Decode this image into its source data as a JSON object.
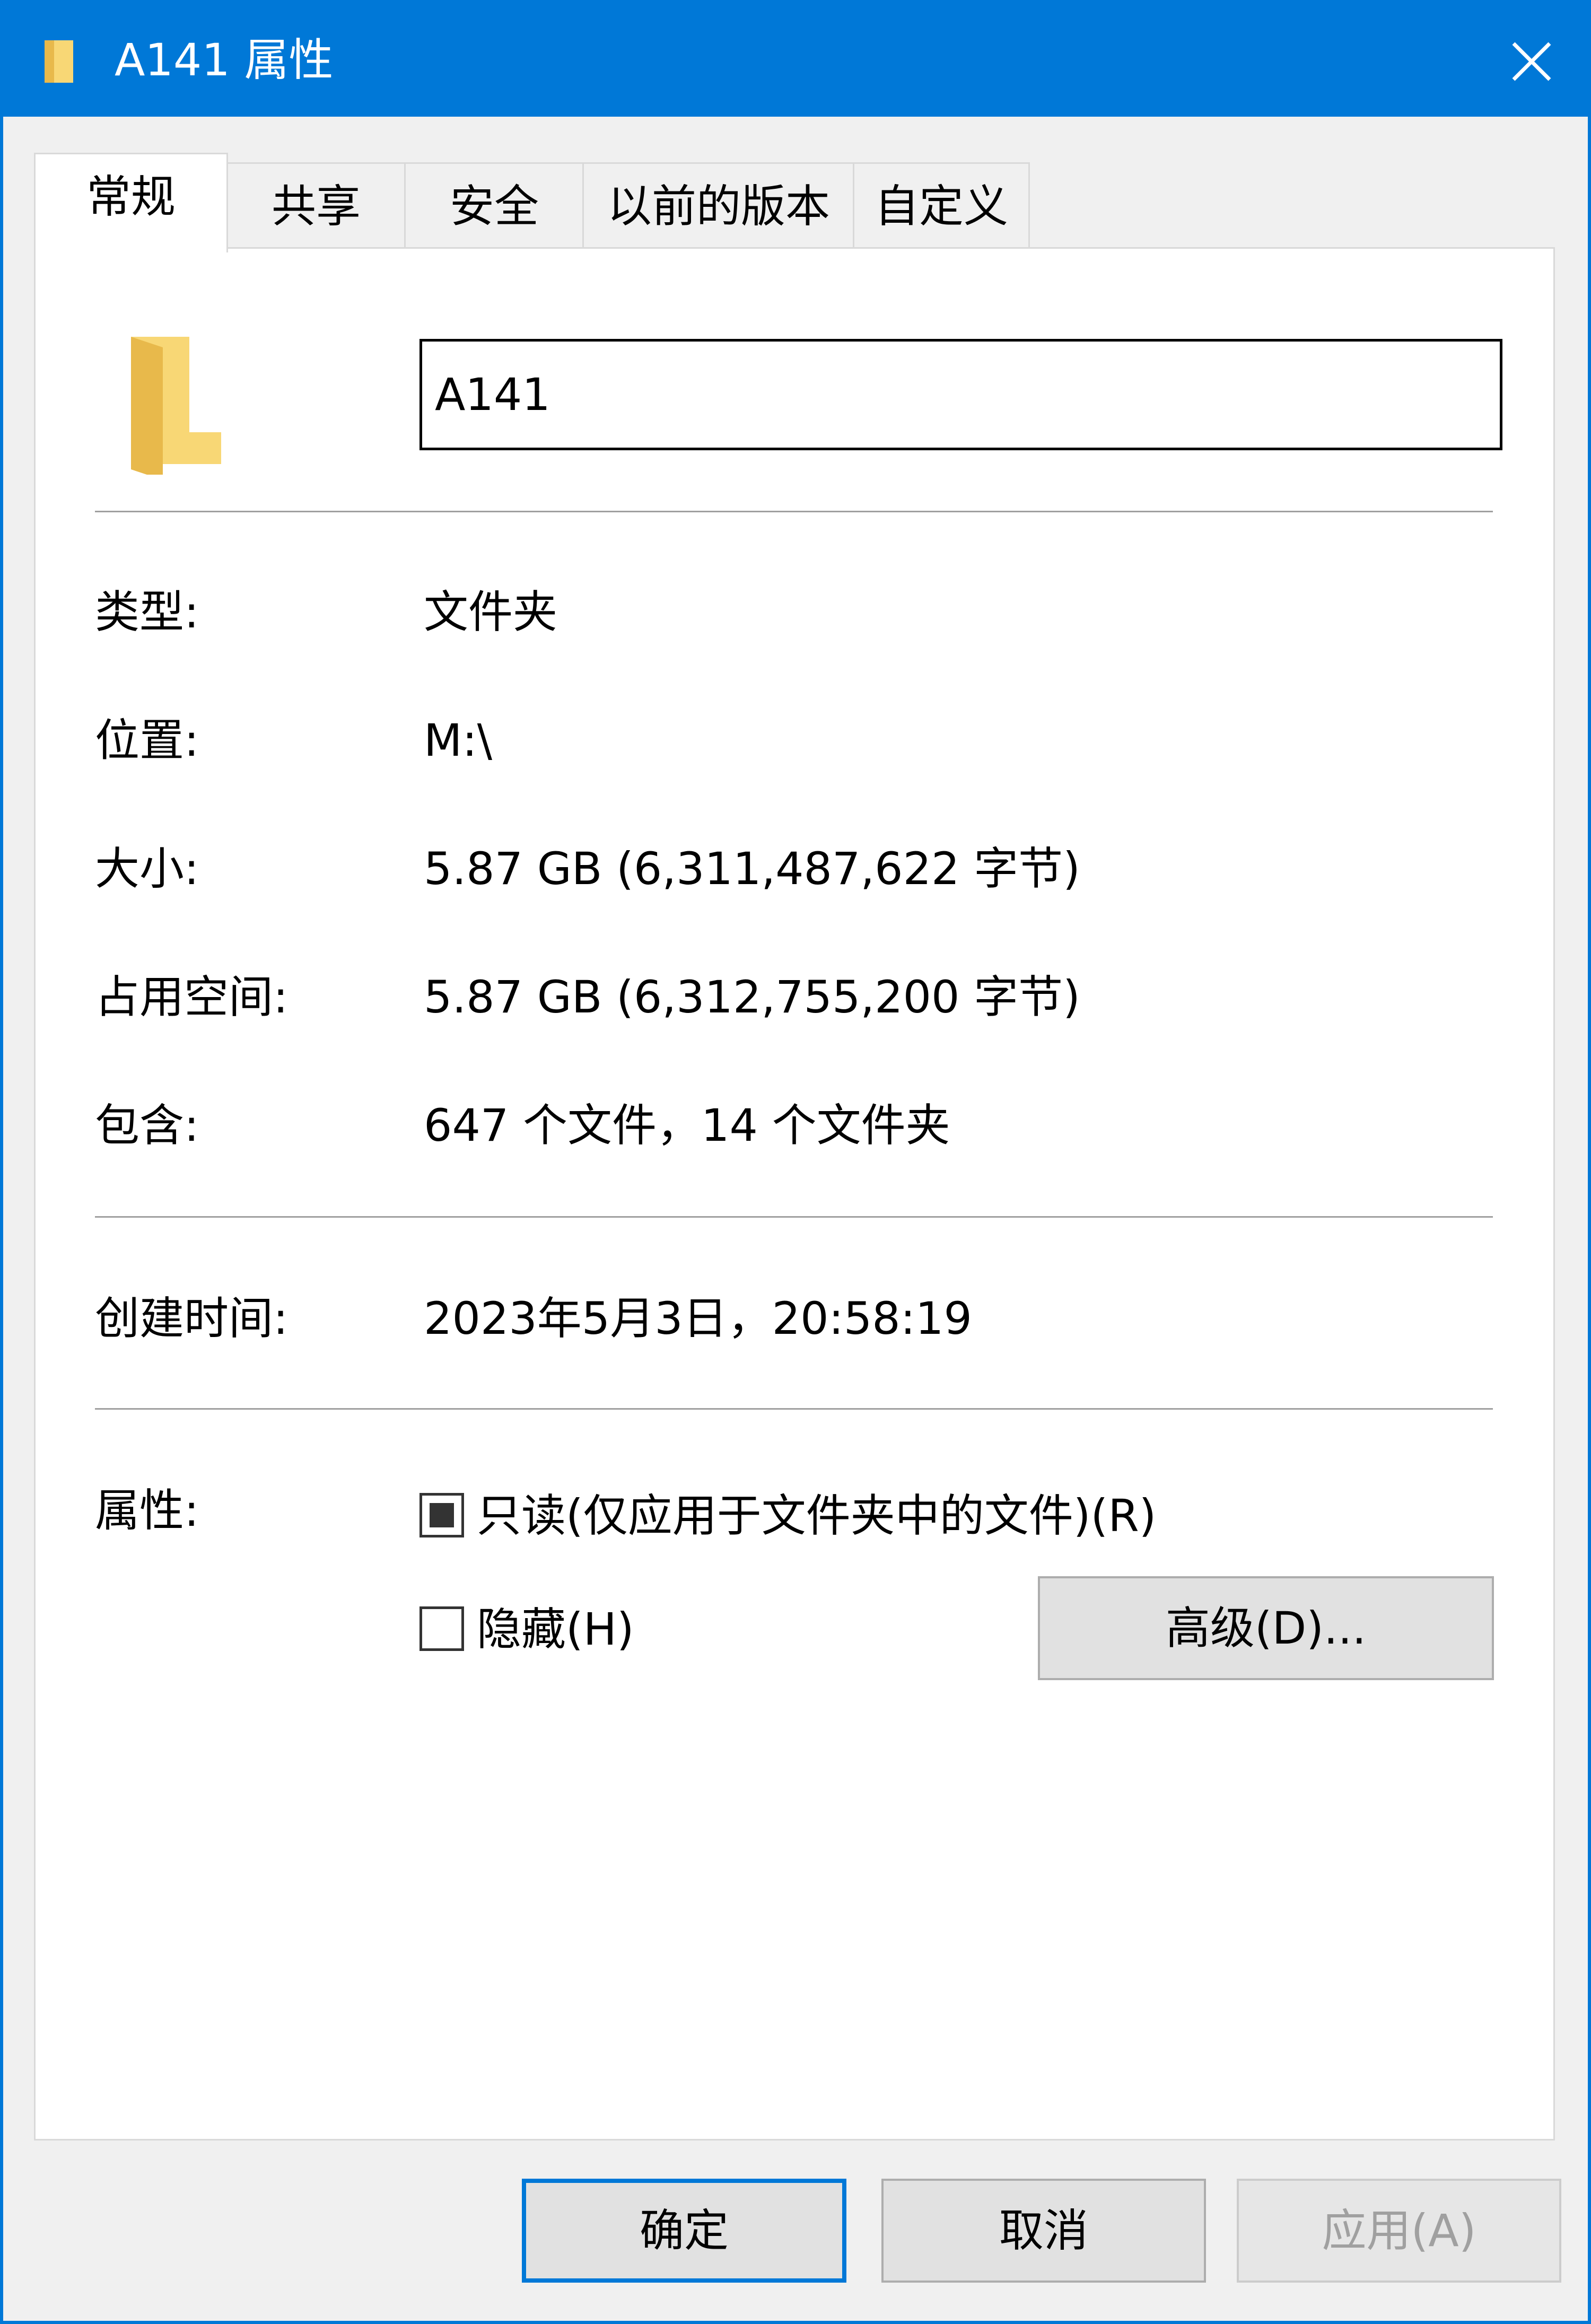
{
  "window": {
    "title": "A141 属性",
    "accent_color": "#0078d7",
    "title_icon": "folder-icon",
    "close_icon": "close-icon"
  },
  "tabs": [
    {
      "label": "常规",
      "active": true
    },
    {
      "label": "共享",
      "active": false
    },
    {
      "label": "安全",
      "active": false
    },
    {
      "label": "以前的版本",
      "active": false
    },
    {
      "label": "自定义",
      "active": false
    }
  ],
  "general": {
    "folder_icon": "folder-icon",
    "name_value": "A141",
    "type_label": "类型:",
    "type_value": "文件夹",
    "location_label": "位置:",
    "location_value": "M:\\",
    "size_label": "大小:",
    "size_value": "5.87 GB (6,311,487,622 字节)",
    "disk_size_label": "占用空间:",
    "disk_size_value": "5.87 GB (6,312,755,200 字节)",
    "contains_label": "包含:",
    "contains_value": "647 个文件，14 个文件夹",
    "created_label": "创建时间:",
    "created_value": "2023年5月3日，20:58:19",
    "attributes_label": "属性:",
    "readonly_label": "只读(仅应用于文件夹中的文件)(R)",
    "readonly_state": "indeterminate",
    "hidden_label": "隐藏(H)",
    "hidden_checked": false,
    "advanced_button": "高级(D)..."
  },
  "footer": {
    "ok": "确定",
    "cancel": "取消",
    "apply": "应用(A)"
  }
}
